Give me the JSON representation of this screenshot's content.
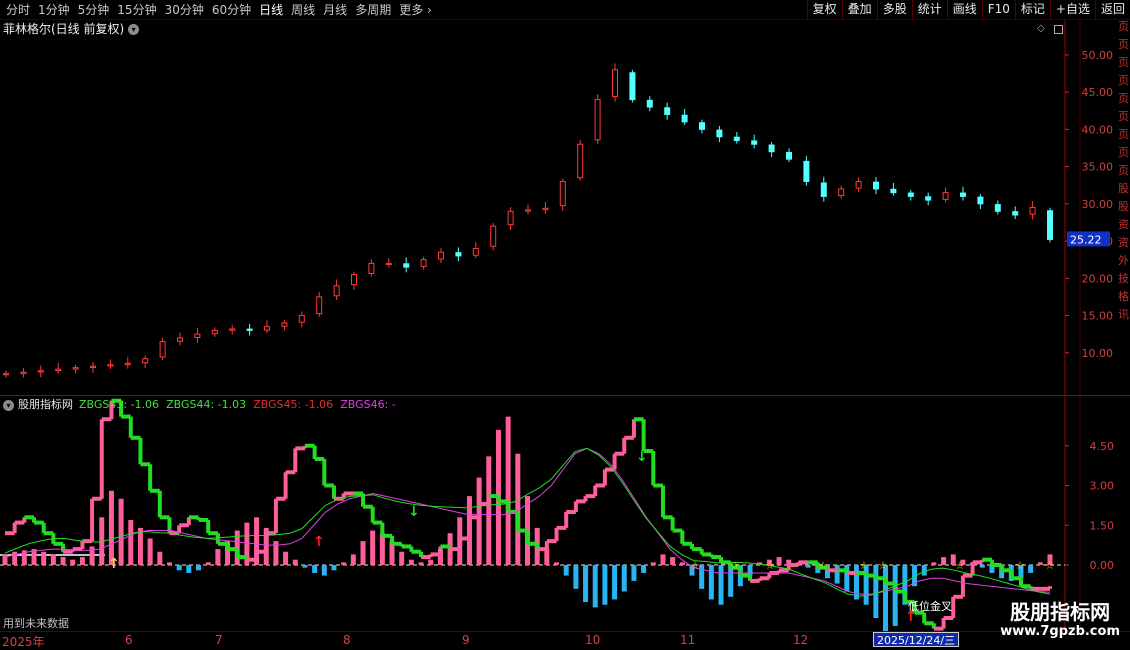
{
  "toolbar": {
    "period_tabs": [
      "分时",
      "1分钟",
      "5分钟",
      "15分钟",
      "30分钟",
      "60分钟",
      "日线",
      "周线",
      "月线",
      "多周期",
      "更多"
    ],
    "active_tab": "日线",
    "right_buttons": [
      "复权",
      "叠加",
      "多股",
      "统计",
      "画线",
      "F10",
      "标记",
      "+自选",
      "返回"
    ]
  },
  "main_panel": {
    "title": "菲林格尔(日线 前复权)",
    "price_axis": [
      "50.00",
      "45.00",
      "40.00",
      "35.00",
      "30.00",
      "25.00",
      "20.00",
      "15.00",
      "10.00"
    ],
    "current_price": "25.22"
  },
  "sub_panel": {
    "name": "股朋指标网",
    "legends": [
      {
        "text": "ZBGS43: -1.06",
        "color": "#40e040"
      },
      {
        "text": "ZBGS44: -1.03",
        "color": "#40e040"
      },
      {
        "text": "ZBGS45: -1.06",
        "color": "#e03030"
      },
      {
        "text": "ZBGS46: -",
        "color": "#e040e0"
      }
    ],
    "axis": [
      "4.50",
      "3.00",
      "1.50",
      "0.00"
    ],
    "annotation": "低位金叉",
    "future_note": "用到未来数据"
  },
  "x_axis": {
    "labels": [
      {
        "text": "2025年"
      },
      {
        "text": "6"
      },
      {
        "text": "7"
      },
      {
        "text": "8"
      },
      {
        "text": "9"
      },
      {
        "text": "10"
      },
      {
        "text": "11"
      },
      {
        "text": "12"
      }
    ],
    "cursor_date": "2025/12/24/三"
  },
  "right_strip_chars": [
    "页",
    "页",
    "页",
    "页",
    "页",
    "页",
    "页",
    "页",
    "页",
    "股",
    "股",
    "资",
    "资",
    "外",
    "技",
    "格",
    "讯"
  ],
  "watermark": {
    "name": "股朋指标网",
    "url": "www.7gpzb.com"
  },
  "chart_data": {
    "type": "candlestick",
    "title": "菲林格尔(日线 前复权)",
    "x": [
      "2025-06",
      "2025-07",
      "2025-08",
      "2025-09",
      "2025-10",
      "2025-11",
      "2025-12"
    ],
    "close": [
      7.2,
      7.4,
      7.6,
      7.8,
      8.0,
      8.2,
      8.4,
      8.6,
      9.2,
      11.5,
      12.0,
      12.5,
      13.0,
      13.2,
      13.0,
      13.5,
      14.0,
      15.0,
      17.5,
      19.0,
      20.5,
      22.0,
      22.0,
      21.5,
      22.5,
      23.5,
      23.0,
      24.0,
      27.0,
      29.0,
      29.2,
      29.4,
      33.0,
      38.0,
      44.0,
      48.0,
      44.0,
      43.0,
      42.0,
      41.0,
      40.0,
      39.0,
      38.5,
      38.0,
      37.0,
      36.0,
      33.0,
      31.0,
      32.0,
      33.0,
      32.0,
      31.5,
      31.0,
      30.5,
      31.5,
      31.0,
      30.0,
      29.0,
      28.5,
      29.5,
      25.22
    ],
    "ylim": [
      5,
      52
    ],
    "current_price": 25.22,
    "indicator": {
      "series": [
        {
          "name": "ZBGS43",
          "last": -1.06
        },
        {
          "name": "ZBGS44",
          "last": -1.03
        },
        {
          "name": "ZBGS45",
          "last": -1.06
        },
        {
          "name": "ZBGS46",
          "last": null
        }
      ],
      "hist": [
        0.4,
        0.5,
        0.55,
        0.6,
        0.5,
        0.4,
        0.3,
        0.2,
        0.3,
        0.7,
        1.8,
        2.8,
        2.5,
        1.7,
        1.4,
        1.0,
        0.5,
        0.1,
        -0.2,
        -0.3,
        -0.2,
        0.1,
        0.6,
        0.9,
        1.3,
        1.6,
        1.8,
        1.4,
        0.9,
        0.5,
        0.2,
        -0.1,
        -0.3,
        -0.4,
        -0.2,
        0.1,
        0.4,
        0.9,
        1.3,
        1.2,
        0.9,
        0.5,
        0.2,
        0.1,
        0.2,
        0.6,
        1.2,
        1.8,
        2.6,
        3.3,
        4.1,
        5.1,
        5.6,
        4.2,
        2.6,
        1.4,
        0.6,
        0.1,
        -0.4,
        -0.9,
        -1.4,
        -1.6,
        -1.5,
        -1.3,
        -1.0,
        -0.6,
        -0.3,
        0.1,
        0.4,
        0.3,
        0.1,
        -0.4,
        -0.9,
        -1.3,
        -1.5,
        -1.2,
        -0.8,
        -0.4,
        0.1,
        0.2,
        0.3,
        0.2,
        0.1,
        -0.1,
        -0.3,
        -0.5,
        -0.7,
        -1.0,
        -1.3,
        -1.5,
        -2.0,
        -2.6,
        -2.3,
        -1.5,
        -0.8,
        -0.4,
        0.1,
        0.3,
        0.4,
        0.2,
        0.1,
        -0.1,
        -0.3,
        -0.5,
        -0.6,
        -0.5,
        -0.3,
        0.1,
        0.4
      ],
      "fast": [
        1.2,
        1.6,
        1.8,
        1.6,
        1.2,
        0.8,
        0.5,
        0.6,
        0.9,
        2.5,
        5.5,
        6.2,
        5.6,
        4.8,
        3.8,
        2.8,
        1.8,
        1.2,
        1.5,
        1.8,
        1.7,
        1.2,
        0.8,
        0.6,
        0.3,
        0.2,
        0.5,
        1.2,
        2.5,
        3.5,
        4.4,
        4.5,
        4.0,
        3.0,
        2.5,
        2.7,
        2.7,
        2.2,
        1.6,
        1.1,
        0.8,
        0.7,
        0.5,
        0.3,
        0.4,
        0.7,
        0.6,
        1.0,
        1.8,
        2.3,
        2.6,
        2.4,
        2.0,
        1.3,
        0.8,
        0.6,
        0.9,
        1.4,
        2.0,
        2.4,
        2.6,
        3.0,
        3.6,
        4.2,
        4.8,
        5.5,
        4.3,
        3.0,
        1.8,
        1.3,
        0.8,
        0.6,
        0.4,
        0.3,
        0.1,
        -0.1,
        -0.4,
        -0.6,
        -0.5,
        -0.3,
        -0.2,
        0.0,
        0.1,
        0.1,
        -0.1,
        -0.2,
        -0.2,
        -0.3,
        -0.3,
        -0.4,
        -0.5,
        -0.7,
        -1.0,
        -1.4,
        -1.8,
        -2.2,
        -2.4,
        -2.0,
        -1.2,
        -0.4,
        0.1,
        0.2,
        0.0,
        -0.2,
        -0.5,
        -0.8,
        -0.9,
        -0.9,
        -0.8
      ],
      "mid": [
        0.3,
        0.4,
        0.5,
        0.55,
        0.6,
        0.6,
        0.55,
        0.55,
        0.6,
        0.8,
        1.0,
        1.2,
        1.3,
        1.3,
        1.3,
        1.2,
        1.1,
        1.0,
        0.95,
        0.9,
        0.85,
        0.8,
        0.75,
        0.75,
        0.8,
        1.0,
        1.5,
        2.0,
        2.3,
        2.5,
        2.6,
        2.7,
        2.6,
        2.5,
        2.4,
        2.3,
        2.2,
        2.1,
        2.0,
        1.9,
        1.9,
        1.9,
        1.9,
        2.0,
        2.3,
        2.6,
        3.0,
        3.6,
        4.2,
        4.4,
        4.2,
        3.8,
        3.2,
        2.5,
        1.8,
        1.2,
        0.6,
        0.2,
        -0.1,
        -0.2,
        -0.3,
        -0.3,
        -0.3,
        -0.3,
        -0.3,
        -0.3,
        -0.3,
        -0.4,
        -0.5,
        -0.6,
        -0.8,
        -1.0,
        -1.1,
        -1.1,
        -1.0,
        -0.9,
        -0.8,
        -0.6,
        -0.5,
        -0.5,
        -0.6,
        -0.7,
        -0.75,
        -0.8,
        -0.85,
        -0.9,
        -0.95,
        -1.0,
        -1.03
      ]
    }
  }
}
